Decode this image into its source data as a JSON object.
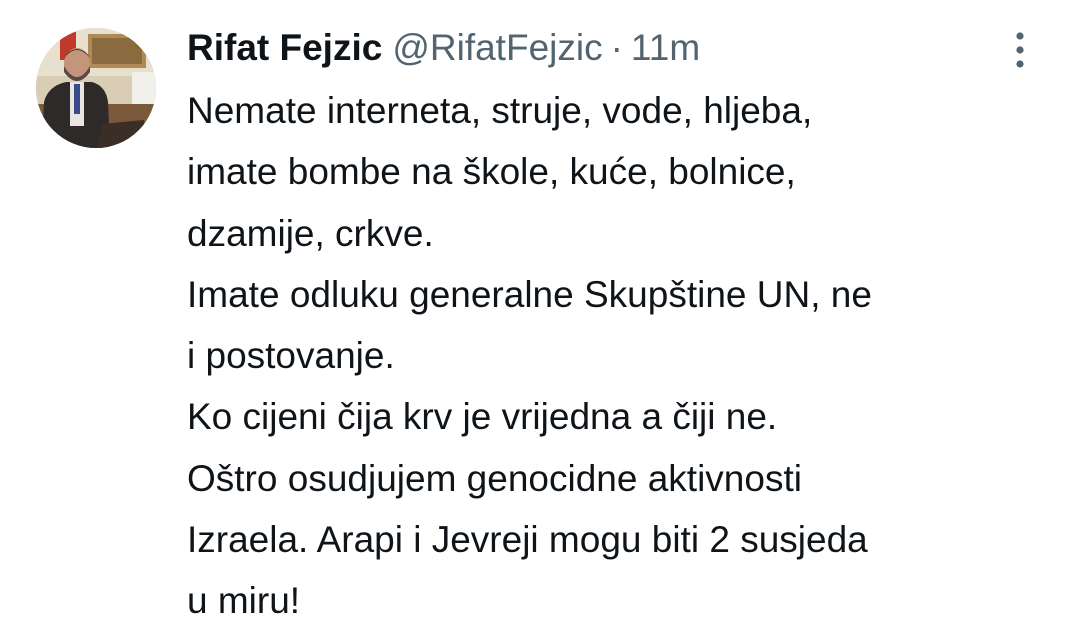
{
  "tweet": {
    "author": {
      "display_name": "Rifat Fejzic",
      "handle": "@RifatFejzic"
    },
    "separator": "·",
    "timestamp": "11m",
    "more_icon": "more-vertical-icon",
    "text_lines": [
      "Nemate interneta, struje, vode, hljeba,",
      "imate bombe na škole, kuće, bolnice,",
      "dzamije, crkve.",
      "Imate odluku generalne Skupštine UN, ne",
      "i postovanje.",
      "Ko cijeni čija krv je vrijedna a čiji ne.",
      "Oštro osudjujem genocidne aktivnosti",
      "Izraela. Arapi i Jevreji mogu biti 2 susjeda",
      "u miru!"
    ]
  },
  "colors": {
    "text_primary": "#0f1419",
    "text_secondary": "#536471",
    "icon_secondary": "#536471",
    "background": "#ffffff"
  }
}
